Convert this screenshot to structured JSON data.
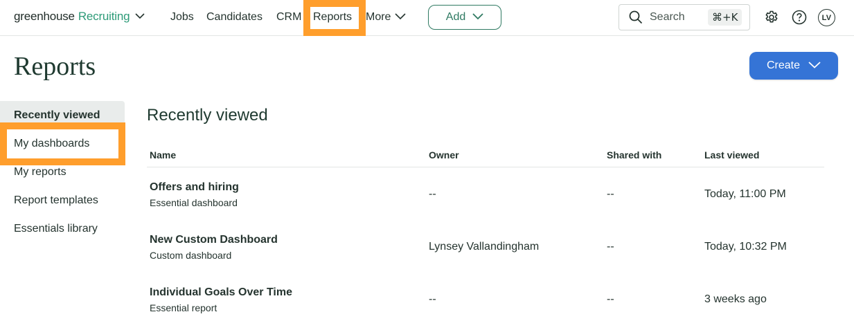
{
  "brand": {
    "name_part1": "greenhouse",
    "name_part2": "Recruiting",
    "accent": "#2e9b78"
  },
  "nav": {
    "jobs": "Jobs",
    "candidates": "Candidates",
    "crm": "CRM",
    "reports": "Reports",
    "more": "More",
    "add": "Add",
    "search_placeholder": "Search",
    "search_shortcut": "⌘+K",
    "avatar_initials": "LV"
  },
  "icons": [
    "chevron-down-icon",
    "search-icon",
    "gear-icon",
    "help-icon"
  ],
  "page": {
    "title": "Reports",
    "create_label": "Create"
  },
  "sidebar": {
    "items": [
      {
        "label": "Recently viewed"
      },
      {
        "label": "My dashboards"
      },
      {
        "label": "My reports"
      },
      {
        "label": "Report templates"
      },
      {
        "label": "Essentials library"
      }
    ]
  },
  "main": {
    "section_title": "Recently viewed",
    "columns": [
      "Name",
      "Owner",
      "Shared with",
      "Last viewed"
    ],
    "rows": [
      {
        "name": "Offers and hiring",
        "type": "Essential dashboard",
        "owner": "--",
        "shared": "--",
        "last_viewed": "Today, 11:00 PM"
      },
      {
        "name": "New Custom Dashboard",
        "type": "Custom dashboard",
        "owner": "Lynsey Vallandingham",
        "shared": "--",
        "last_viewed": "Today, 10:32 PM"
      },
      {
        "name": "Individual Goals Over Time",
        "type": "Essential report",
        "owner": "--",
        "shared": "--",
        "last_viewed": "3 weeks ago"
      }
    ]
  },
  "colors": {
    "highlight": "#ff9e2c",
    "primary_button": "#3574d6",
    "add_button_border": "#2f7a62",
    "title_text": "#1f3a30"
  }
}
